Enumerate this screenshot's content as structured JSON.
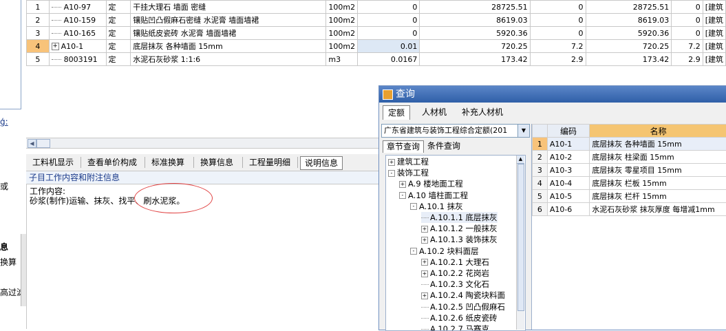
{
  "grid": {
    "rows": [
      {
        "no": "1",
        "code": "A10-97",
        "type": "定",
        "name": "干挂大理石 墙面 密缝",
        "unit": "100m2",
        "qty": "0",
        "price": "28725.51",
        "c1": "0",
        "total": "28725.51",
        "c2": "0",
        "tag": "[建筑"
      },
      {
        "no": "2",
        "code": "A10-159",
        "type": "定",
        "name": "镶贴凹凸假麻石密缝 水泥膏 墙面墙裙",
        "unit": "100m2",
        "qty": "0",
        "price": "8619.03",
        "c1": "0",
        "total": "8619.03",
        "c2": "0",
        "tag": "[建筑"
      },
      {
        "no": "3",
        "code": "A10-165",
        "type": "定",
        "name": "镶贴纸皮瓷砖 水泥膏 墙面墙裙",
        "unit": "100m2",
        "qty": "0",
        "price": "5920.36",
        "c1": "0",
        "total": "5920.36",
        "c2": "0",
        "tag": "[建筑"
      },
      {
        "no": "4",
        "code": "A10-1",
        "type": "定",
        "name": "底层抹灰 各种墙面 15mm",
        "unit": "100m2",
        "qty": "0.01",
        "price": "720.25",
        "c1": "7.2",
        "total": "720.25",
        "c2": "7.2",
        "tag": "[建筑"
      },
      {
        "no": "5",
        "code": "8003191",
        "type": "定",
        "name": "水泥石灰砂浆 1:1:6",
        "unit": "m3",
        "qty": "0.0167",
        "price": "173.42",
        "c1": "2.9",
        "total": "173.42",
        "c2": "2.9",
        "tag": "[建筑"
      }
    ],
    "expand_glyph": "+"
  },
  "left_fragments": [
    "ģ:",
    "或",
    "息",
    "换算",
    "高过滤"
  ],
  "tabbar": {
    "tabs": [
      "工料机显示",
      "查看单价构成",
      "标准换算",
      "换算信息",
      "工程量明细",
      "说明信息"
    ],
    "active": "说明信息"
  },
  "info": {
    "header": "子目工作内容和附注信息",
    "line1": "工作内容:",
    "line2": "砂浆(制作)运输、抹灰、找平、刷水泥浆。"
  },
  "dialog": {
    "title": "查询",
    "tabs": [
      "定额",
      "人材机",
      "补充人材机"
    ],
    "dropdown_value": "广东省建筑与装饰工程综合定额(201",
    "subtabs": [
      "章节查询",
      "条件查询"
    ],
    "tree": [
      {
        "exp": "+",
        "label": "建筑工程",
        "level": 0
      },
      {
        "exp": "-",
        "label": "装饰工程",
        "level": 0
      },
      {
        "exp": "+",
        "label": "A.9 楼地面工程",
        "level": 1
      },
      {
        "exp": "-",
        "label": "A.10 墙柱面工程",
        "level": 1
      },
      {
        "exp": "-",
        "label": "A.10.1 抹灰",
        "level": 2
      },
      {
        "exp": "",
        "label": "A.10.1.1 底层抹灰",
        "level": 3,
        "selected": true
      },
      {
        "exp": "+",
        "label": "A.10.1.2 一般抹灰",
        "level": 3
      },
      {
        "exp": "+",
        "label": "A.10.1.3 装饰抹灰",
        "level": 3
      },
      {
        "exp": "-",
        "label": "A.10.2 块料面层",
        "level": 2
      },
      {
        "exp": "+",
        "label": "A.10.2.1 大理石",
        "level": 3
      },
      {
        "exp": "+",
        "label": "A.10.2.2 花岗岩",
        "level": 3
      },
      {
        "exp": "",
        "label": "A.10.2.3 文化石",
        "level": 3
      },
      {
        "exp": "+",
        "label": "A.10.2.4 陶瓷块料面",
        "level": 3
      },
      {
        "exp": "",
        "label": "A.10.2.5 凹凸假麻石",
        "level": 3
      },
      {
        "exp": "",
        "label": "A.10.2.6 纸皮瓷砖",
        "level": 3
      },
      {
        "exp": "",
        "label": "A.10.2.7 马赛克",
        "level": 3
      }
    ],
    "results": {
      "headers": [
        "",
        "编码",
        "名称"
      ],
      "rows": [
        {
          "no": "1",
          "code": "A10-1",
          "name": "底层抹灰 各种墙面 15mm"
        },
        {
          "no": "2",
          "code": "A10-2",
          "name": "底层抹灰 柱梁面 15mm"
        },
        {
          "no": "3",
          "code": "A10-3",
          "name": "底层抹灰 零星项目 15mm"
        },
        {
          "no": "4",
          "code": "A10-4",
          "name": "底层抹灰 栏板 15mm"
        },
        {
          "no": "5",
          "code": "A10-5",
          "name": "底层抹灰 栏杆 15mm"
        },
        {
          "no": "6",
          "code": "A10-6",
          "name": "水泥石灰砂浆 抹灰厚度 每增减1mm"
        }
      ]
    }
  },
  "colors": {
    "accent": "#2f5fa8",
    "selected_row": "#f8c37a",
    "annotation": "#e04040"
  }
}
